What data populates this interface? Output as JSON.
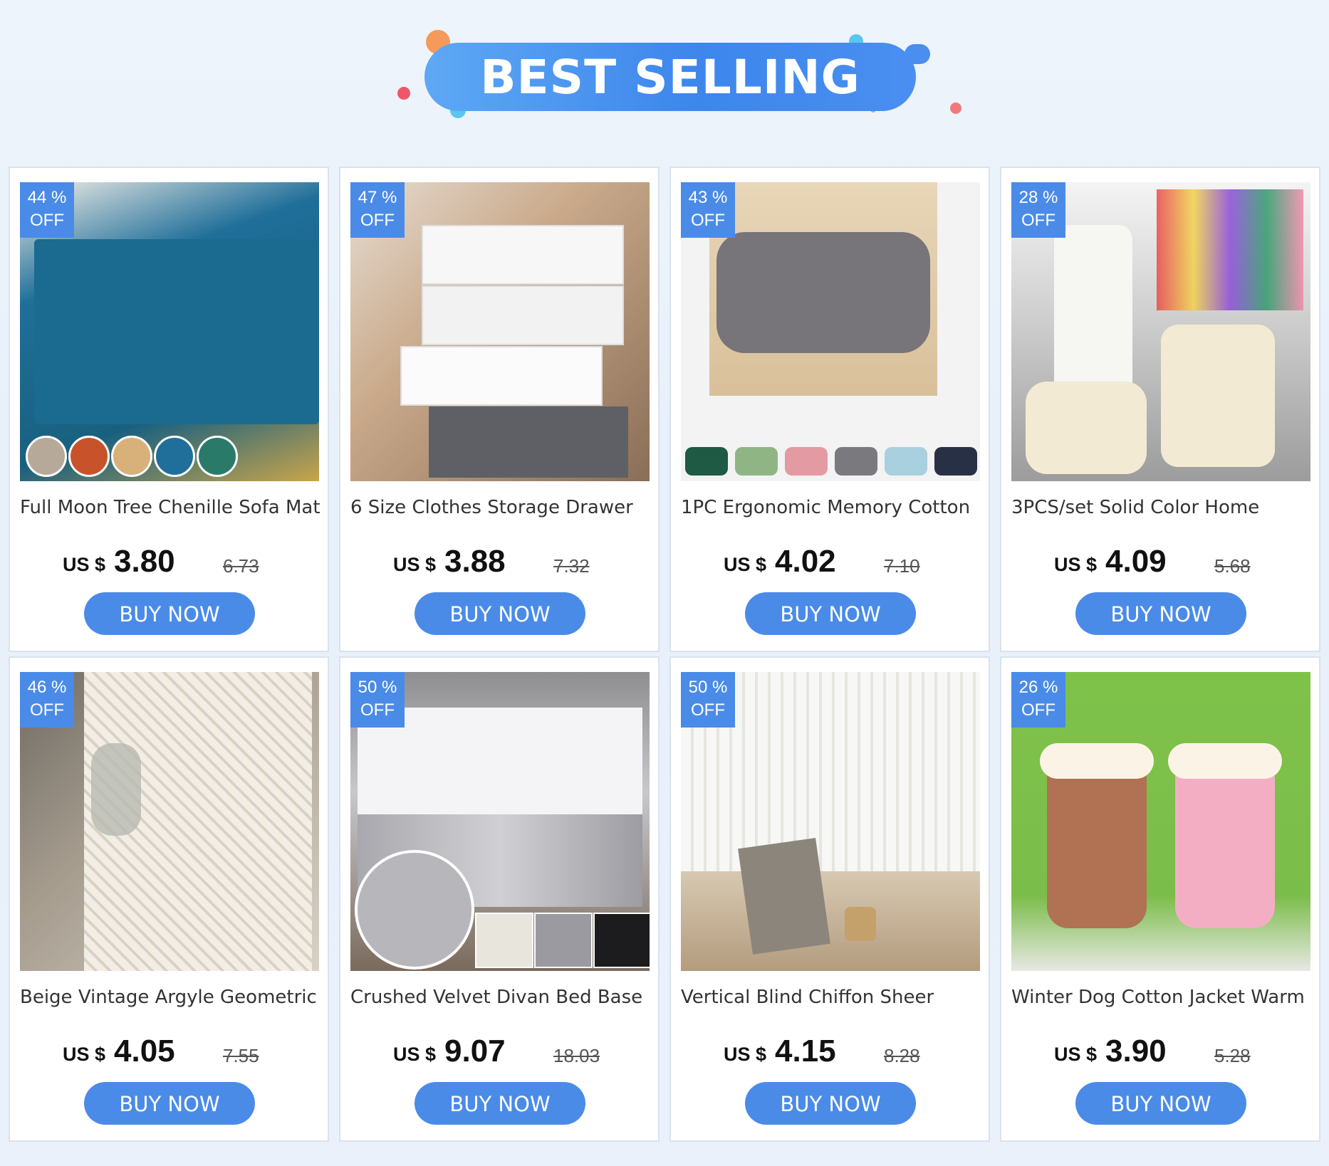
{
  "banner": {
    "title": "BEST SELLING"
  },
  "colors": {
    "accent": "#4a8be8",
    "banner_start": "#5ea8f5",
    "banner_end": "#3d86ec"
  },
  "products": [
    {
      "title": "Full Moon Tree Chenille Sofa Mat",
      "discount_pct": "44  %",
      "off": "OFF",
      "currency": "US $",
      "price": "3.80",
      "old_price": "6.73",
      "buy": "BUY NOW"
    },
    {
      "title": "6 Size Clothes Storage Drawer",
      "discount_pct": "47  %",
      "off": "OFF",
      "currency": "US $",
      "price": "3.88",
      "old_price": "7.32",
      "buy": "BUY NOW"
    },
    {
      "title": "1PC Ergonomic Memory Cotton",
      "discount_pct": "43  %",
      "off": "OFF",
      "currency": "US $",
      "price": "4.02",
      "old_price": "7.10",
      "buy": "BUY NOW"
    },
    {
      "title": "3PCS/set Solid Color Home",
      "discount_pct": "28  %",
      "off": "OFF",
      "currency": "US $",
      "price": "4.09",
      "old_price": "5.68",
      "buy": "BUY NOW"
    },
    {
      "title": "Beige Vintage Argyle Geometric",
      "discount_pct": "46  %",
      "off": "OFF",
      "currency": "US $",
      "price": "4.05",
      "old_price": "7.55",
      "buy": "BUY NOW"
    },
    {
      "title": "Crushed Velvet Divan Bed Base",
      "discount_pct": "50  %",
      "off": "OFF",
      "currency": "US $",
      "price": "9.07",
      "old_price": "18.03",
      "buy": "BUY NOW"
    },
    {
      "title": "Vertical Blind Chiffon Sheer",
      "discount_pct": "50  %",
      "off": "OFF",
      "currency": "US $",
      "price": "4.15",
      "old_price": "8.28",
      "buy": "BUY NOW"
    },
    {
      "title": "Winter Dog Cotton Jacket Warm",
      "discount_pct": "26  %",
      "off": "OFF",
      "currency": "US $",
      "price": "3.90",
      "old_price": "5.28",
      "buy": "BUY NOW"
    }
  ]
}
